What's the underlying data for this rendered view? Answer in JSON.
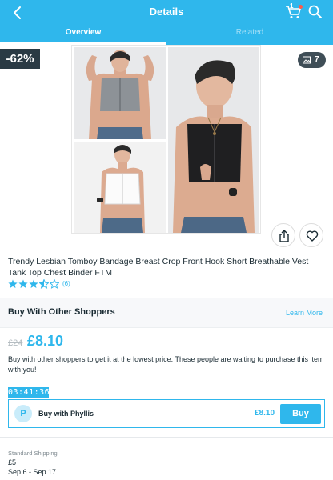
{
  "header": {
    "title": "Details",
    "cart_count": "1",
    "tabs": [
      {
        "label": "Overview",
        "active": true
      },
      {
        "label": "Related",
        "active": false
      }
    ]
  },
  "colors": {
    "accent": "#2fb7ec",
    "dark": "#2a3a44",
    "text": "#192a32",
    "star": "#2fb7ec",
    "cart_badge": "#ff5a47"
  },
  "icons": [
    "back-arrow-icon",
    "cart-icon",
    "search-icon",
    "image-icon",
    "share-icon",
    "heart-icon",
    "star-icon"
  ],
  "product": {
    "discount": "-62%",
    "image_count": "7",
    "name": "Trendy Lesbian Tomboy Bandage Breast Crop Front Hook Short Breathable Vest Tank Top Chest Binder FTM",
    "rating": 3.5,
    "rating_count": "(6)"
  },
  "group_buy": {
    "section_title": "Buy With Other Shoppers",
    "learn_more": "Learn More",
    "original_price": "£24",
    "price": "£8.10",
    "description": "Buy with other shoppers to get it at the lowest price. These people are waiting to purchase this item with you!",
    "timer": "03:41:36",
    "shopper": {
      "initial": "P",
      "label": "Buy with Phyllis",
      "price": "£8.10",
      "button": "Buy"
    }
  },
  "shipping": {
    "label": "Standard Shipping",
    "price": "£5",
    "dates": "Sep 6 - Sep 17"
  }
}
